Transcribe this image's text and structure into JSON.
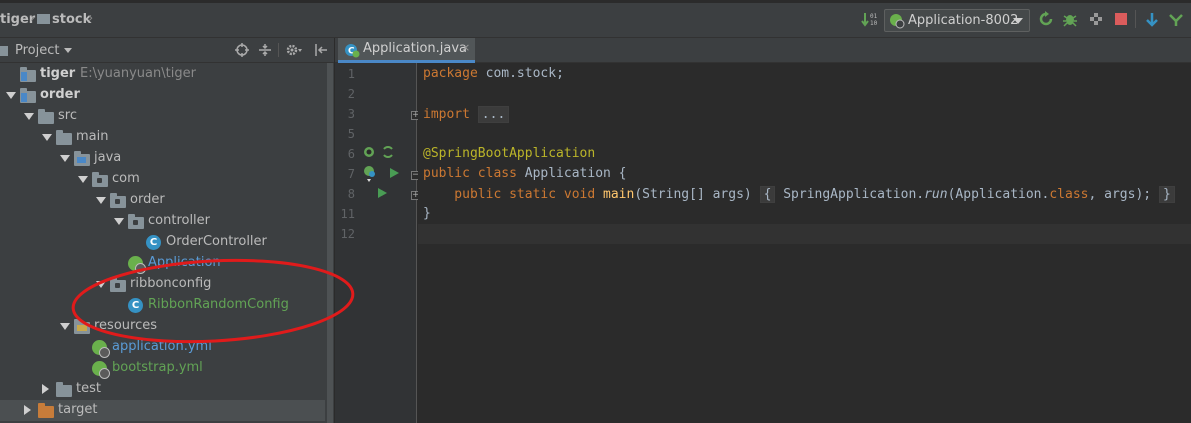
{
  "breadcrumb": {
    "items": [
      "tiger",
      "stock"
    ]
  },
  "toolbar": {
    "run_config": "Application-8002",
    "icons": [
      "sort-icon",
      "spring-run-config-icon",
      "rerun-icon",
      "debug-icon",
      "coverage-icon",
      "stop-icon",
      "vcs-update-icon",
      "vcs-commit-icon"
    ]
  },
  "project_panel": {
    "title": "Project",
    "tree": [
      {
        "label": "tiger",
        "path": "E:\\yuanyuan\\tiger",
        "depth": 0,
        "icon": "module-folder-icon",
        "expanded": null,
        "bold": true,
        "color": "grey"
      },
      {
        "label": "order",
        "depth": 0,
        "icon": "module-folder-icon",
        "expanded": true,
        "bold": true,
        "color": "grey"
      },
      {
        "label": "src",
        "depth": 1,
        "icon": "folder-icon",
        "expanded": true,
        "color": "grey"
      },
      {
        "label": "main",
        "depth": 2,
        "icon": "folder-icon",
        "expanded": true,
        "color": "grey"
      },
      {
        "label": "java",
        "depth": 3,
        "icon": "source-folder-icon",
        "expanded": true,
        "color": "grey"
      },
      {
        "label": "com",
        "depth": 4,
        "icon": "package-icon",
        "expanded": true,
        "color": "grey"
      },
      {
        "label": "order",
        "depth": 5,
        "icon": "package-icon",
        "expanded": true,
        "color": "grey"
      },
      {
        "label": "controller",
        "depth": 6,
        "icon": "package-icon",
        "expanded": true,
        "color": "grey"
      },
      {
        "label": "OrderController",
        "depth": 7,
        "icon": "class-icon",
        "color": "grey"
      },
      {
        "label": "Application",
        "depth": 6,
        "icon": "spring-boot-class-icon",
        "color": "blue"
      },
      {
        "label": "ribbonconfig",
        "depth": 5,
        "icon": "package-icon",
        "expanded": true,
        "color": "grey"
      },
      {
        "label": "RibbonRandomConfig",
        "depth": 6,
        "icon": "class-icon",
        "color": "green"
      },
      {
        "label": "resources",
        "depth": 3,
        "icon": "resources-folder-icon",
        "expanded": true,
        "color": "grey"
      },
      {
        "label": "application.yml",
        "depth": 4,
        "icon": "spring-yml-icon",
        "color": "blue"
      },
      {
        "label": "bootstrap.yml",
        "depth": 4,
        "icon": "spring-yml-icon",
        "color": "green"
      },
      {
        "label": "test",
        "depth": 2,
        "icon": "folder-icon",
        "expanded": false,
        "color": "grey"
      },
      {
        "label": "target",
        "depth": 1,
        "icon": "target-folder-icon",
        "expanded": false,
        "color": "grey",
        "selected": true
      }
    ]
  },
  "editor": {
    "tab": {
      "label": "Application.java",
      "close": "×"
    },
    "line_numbers": [
      "1",
      "2",
      "3",
      "5",
      "6",
      "7",
      "8",
      "11",
      "12"
    ],
    "lines": {
      "l1_kw": "package",
      "l1_rest": " com.stock;",
      "l3_kw": "import",
      "l3_fold": "...",
      "l6": "@SpringBootApplication",
      "l7_kw": "public class",
      "l7_rest": " Application {",
      "l8_kw": "    public static void",
      "l8_fn": " main",
      "l8_args": "(String[] args) ",
      "l8_fold_open": "{",
      "l8_body1": " SpringApplication.",
      "l8_run": "run",
      "l8_body2": "(Application.",
      "l8_class_kw": "class",
      "l8_body3": ", args); ",
      "l8_fold_close": "}",
      "l11": "}"
    }
  }
}
